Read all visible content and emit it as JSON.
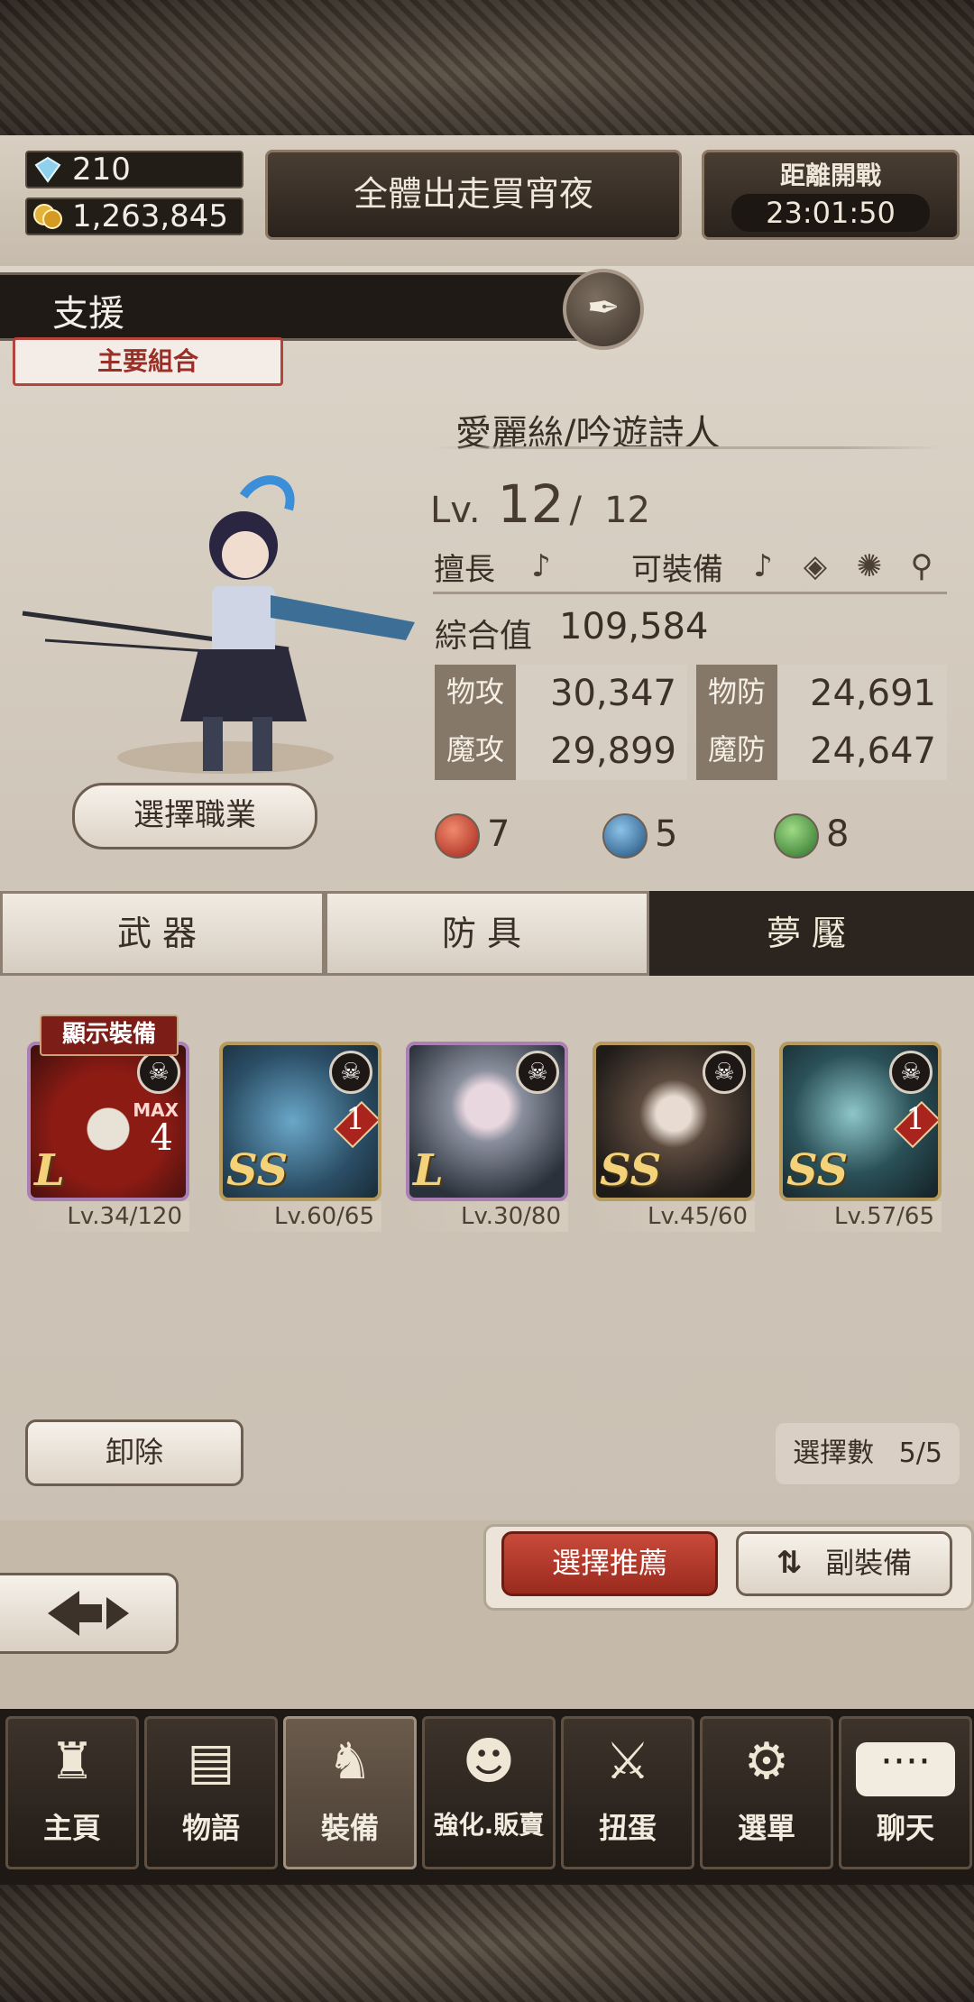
{
  "resources": {
    "crystals": "210",
    "gold": "1,263,845"
  },
  "header": {
    "event_label": "全體出走買宵夜",
    "countdown_title": "距離開戰",
    "countdown_time": "23:01:50"
  },
  "character": {
    "role": "支援",
    "tag": "主要組合",
    "name": "愛麗絲/吟遊詩人",
    "level_prefix": "Lv.",
    "level": "12",
    "level_sep": "/",
    "level_max": "12",
    "specialty_label": "擅長",
    "equip_label": "可裝備",
    "total_label": "綜合值",
    "total_value": "109,584",
    "stats": [
      {
        "label": "物攻",
        "value": "30,347"
      },
      {
        "label": "物防",
        "value": "24,691"
      },
      {
        "label": "魔攻",
        "value": "29,899"
      },
      {
        "label": "魔防",
        "value": "24,647"
      }
    ],
    "elements": [
      {
        "name": "fire",
        "count": "7",
        "color": "#c0392b"
      },
      {
        "name": "water",
        "count": "5",
        "color": "#2e6b9e"
      },
      {
        "name": "wind",
        "count": "8",
        "color": "#3e8b3a"
      }
    ],
    "select_job_label": "選擇職業"
  },
  "tabs": [
    {
      "label": "武器",
      "active": false
    },
    {
      "label": "防具",
      "active": false
    },
    {
      "label": "夢魘",
      "active": true
    }
  ],
  "cards": {
    "show_equip_badge": "顯示裝備",
    "items": [
      {
        "rank": "L",
        "level": "Lv.34/120",
        "max_label": "MAX",
        "max_value": "4",
        "color": "#a3281e"
      },
      {
        "rank": "SS",
        "level": "Lv.60/65",
        "lock": "1",
        "color": "#3f6d88"
      },
      {
        "rank": "L",
        "level": "Lv.30/80",
        "color": "#4a5666"
      },
      {
        "rank": "SS",
        "level": "Lv.45/60",
        "color": "#3a3430"
      },
      {
        "rank": "SS",
        "level": "Lv.57/65",
        "lock": "1",
        "color": "#2d4e55"
      }
    ]
  },
  "actions": {
    "remove": "卸除",
    "select_count_label": "選擇數",
    "select_count_value": "5/5",
    "recommend": "選擇推薦",
    "sub_equip": "副裝備"
  },
  "nav": [
    {
      "label": "主頁",
      "icon": "castle-icon"
    },
    {
      "label": "物語",
      "icon": "book-icon"
    },
    {
      "label": "裝備",
      "icon": "puppet-icon",
      "active": true
    },
    {
      "label": "強化.販賣",
      "icon": "mask-icon"
    },
    {
      "label": "扭蛋",
      "icon": "swords-icon"
    },
    {
      "label": "選單",
      "icon": "gears-icon"
    },
    {
      "label": "聊天",
      "icon": "chat-icon"
    }
  ]
}
